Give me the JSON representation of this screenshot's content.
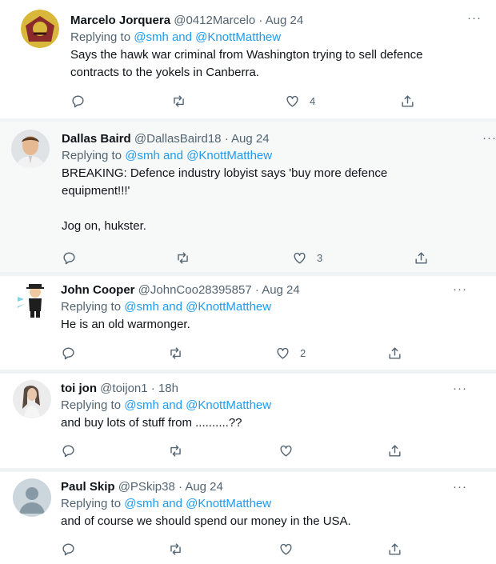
{
  "tweets": [
    {
      "name": "Marcelo Jorquera",
      "handle": "@0412Marcelo",
      "time": "· Aug 24",
      "replying_prefix": "Replying to",
      "mentions": "@smh and @KnottMatthew",
      "text": "Says the hawk war criminal from Washington trying to sell defence\ncontracts to the yokels in Canberra.",
      "likes": "4"
    },
    {
      "name": "Dallas Baird",
      "handle": "@DallasBaird18",
      "time": "· Aug 24",
      "replying_prefix": "Replying to",
      "mentions": "@smh and @KnottMatthew",
      "text": "BREAKING: Defence industry lobyist says 'buy more defence\nequipment!!!'\n\nJog on, hukster.",
      "likes": "3"
    },
    {
      "name": "John Cooper",
      "handle": "@JohnCoo28395857",
      "time": "· Aug 24",
      "replying_prefix": "Replying to",
      "mentions": "@smh and @KnottMatthew",
      "text": "He is an old warmonger.",
      "likes": "2"
    },
    {
      "name": "toi jon",
      "handle": "@toijon1",
      "time": "· 18h",
      "replying_prefix": "Replying to",
      "mentions": "@smh and @KnottMatthew",
      "text": "and buy lots of stuff from ..........??",
      "likes": ""
    },
    {
      "name": "Paul Skip",
      "handle": "@PSkip38",
      "time": "· Aug 24",
      "replying_prefix": "Replying to",
      "mentions": "@smh and @KnottMatthew",
      "text": "and of course we should spend our money in the USA.",
      "likes": ""
    }
  ],
  "more_label": "···",
  "icons": [
    "reply-icon",
    "retweet-icon",
    "like-icon",
    "share-icon",
    "more-icon"
  ],
  "colors": {
    "mention": "#1d9bf0",
    "muted": "#536471",
    "highlight_bg": "#f7f9f9"
  }
}
